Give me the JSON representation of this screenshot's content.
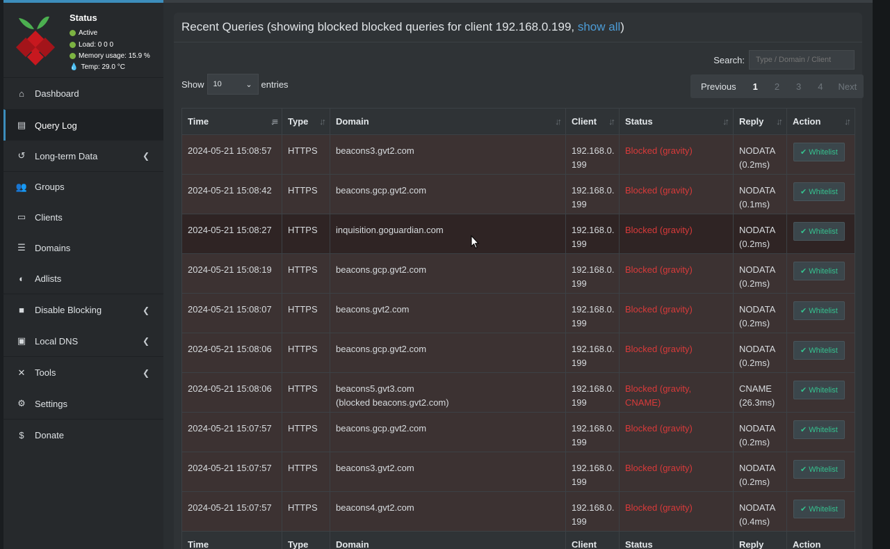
{
  "status": {
    "title": "Status",
    "active": "Active",
    "load": "Load:  0  0  0",
    "memory": "Memory usage:  15.9 %",
    "temp": "Temp: 29.0 °C"
  },
  "menu": [
    {
      "label": "Dashboard",
      "icon": "home-icon",
      "chevron": false
    },
    {
      "label": "Query Log",
      "icon": "file-icon",
      "chevron": false,
      "active": true
    },
    {
      "label": "Long-term Data",
      "icon": "history-icon",
      "chevron": true
    },
    {
      "label": "Groups",
      "icon": "users-icon",
      "chevron": false
    },
    {
      "label": "Clients",
      "icon": "laptop-icon",
      "chevron": false
    },
    {
      "label": "Domains",
      "icon": "list-icon",
      "chevron": false
    },
    {
      "label": "Adlists",
      "icon": "shield-icon",
      "chevron": false
    },
    {
      "label": "Disable Blocking",
      "icon": "stop-icon",
      "chevron": true
    },
    {
      "label": "Local DNS",
      "icon": "address-book-icon",
      "chevron": true
    },
    {
      "label": "Tools",
      "icon": "tools-icon",
      "chevron": true
    },
    {
      "label": "Settings",
      "icon": "gear-icon",
      "chevron": false
    },
    {
      "label": "Donate",
      "icon": "donate-icon",
      "chevron": false
    }
  ],
  "box": {
    "title_prefix": "Recent Queries (showing blocked blocked queries for client 192.168.0.199, ",
    "show_all": "show all",
    "title_suffix": ")"
  },
  "search": {
    "label": "Search:",
    "placeholder": "Type / Domain / Client"
  },
  "length": {
    "show": "Show",
    "value": "10",
    "entries": "entries"
  },
  "pager": {
    "previous": "Previous",
    "pages": [
      "1",
      "2",
      "3",
      "4"
    ],
    "next": "Next"
  },
  "columns": [
    "Time",
    "Type",
    "Domain",
    "Client",
    "Status",
    "Reply",
    "Action"
  ],
  "rows": [
    {
      "time": "2024-05-21 15:08:57",
      "type": "HTTPS",
      "domain": "beacons3.gvt2.com",
      "domain2": "",
      "client1": "192.168.0.",
      "client2": "199",
      "status": "Blocked (gravity)",
      "reply1": "NODATA",
      "reply2": "(0.2ms)",
      "action": "Whitelist"
    },
    {
      "time": "2024-05-21 15:08:42",
      "type": "HTTPS",
      "domain": "beacons.gcp.gvt2.com",
      "domain2": "",
      "client1": "192.168.0.",
      "client2": "199",
      "status": "Blocked (gravity)",
      "reply1": "NODATA",
      "reply2": "(0.1ms)",
      "action": "Whitelist"
    },
    {
      "time": "2024-05-21 15:08:27",
      "type": "HTTPS",
      "domain": "inquisition.goguardian.com",
      "domain2": "",
      "client1": "192.168.0.",
      "client2": "199",
      "status": "Blocked (gravity)",
      "reply1": "NODATA",
      "reply2": "(0.2ms)",
      "action": "Whitelist"
    },
    {
      "time": "2024-05-21 15:08:19",
      "type": "HTTPS",
      "domain": "beacons.gcp.gvt2.com",
      "domain2": "",
      "client1": "192.168.0.",
      "client2": "199",
      "status": "Blocked (gravity)",
      "reply1": "NODATA",
      "reply2": "(0.2ms)",
      "action": "Whitelist"
    },
    {
      "time": "2024-05-21 15:08:07",
      "type": "HTTPS",
      "domain": "beacons.gvt2.com",
      "domain2": "",
      "client1": "192.168.0.",
      "client2": "199",
      "status": "Blocked (gravity)",
      "reply1": "NODATA",
      "reply2": "(0.2ms)",
      "action": "Whitelist"
    },
    {
      "time": "2024-05-21 15:08:06",
      "type": "HTTPS",
      "domain": "beacons.gcp.gvt2.com",
      "domain2": "",
      "client1": "192.168.0.",
      "client2": "199",
      "status": "Blocked (gravity)",
      "reply1": "NODATA",
      "reply2": "(0.2ms)",
      "action": "Whitelist"
    },
    {
      "time": "2024-05-21 15:08:06",
      "type": "HTTPS",
      "domain": "beacons5.gvt3.com",
      "domain2": "(blocked beacons.gvt2.com)",
      "client1": "192.168.0.",
      "client2": "199",
      "status": "Blocked (gravity, CNAME)",
      "reply1": "CNAME",
      "reply2": "(26.3ms)",
      "action": "Whitelist"
    },
    {
      "time": "2024-05-21 15:07:57",
      "type": "HTTPS",
      "domain": "beacons.gcp.gvt2.com",
      "domain2": "",
      "client1": "192.168.0.",
      "client2": "199",
      "status": "Blocked (gravity)",
      "reply1": "NODATA",
      "reply2": "(0.2ms)",
      "action": "Whitelist"
    },
    {
      "time": "2024-05-21 15:07:57",
      "type": "HTTPS",
      "domain": "beacons3.gvt2.com",
      "domain2": "",
      "client1": "192.168.0.",
      "client2": "199",
      "status": "Blocked (gravity)",
      "reply1": "NODATA",
      "reply2": "(0.2ms)",
      "action": "Whitelist"
    },
    {
      "time": "2024-05-21 15:07:57",
      "type": "HTTPS",
      "domain": "beacons4.gvt2.com",
      "domain2": "",
      "client1": "192.168.0.",
      "client2": "199",
      "status": "Blocked (gravity)",
      "reply1": "NODATA",
      "reply2": "(0.4ms)",
      "action": "Whitelist"
    }
  ],
  "colors": {
    "accent": "#3c8dbc",
    "blocked": "#d93a3a",
    "whitelist": "#35c28f"
  }
}
